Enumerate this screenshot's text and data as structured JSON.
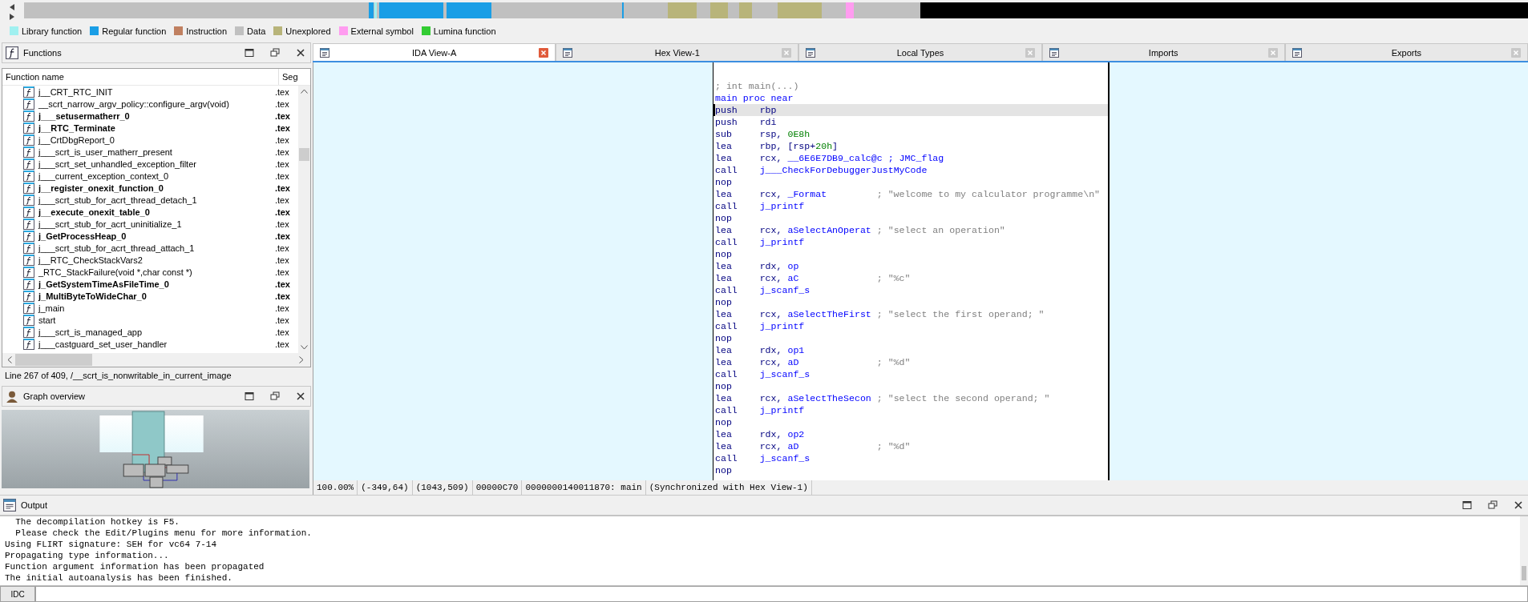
{
  "legend": [
    {
      "label": "Library function",
      "color": "#a0f0f0"
    },
    {
      "label": "Regular function",
      "color": "#1a9ee6"
    },
    {
      "label": "Instruction",
      "color": "#c08060"
    },
    {
      "label": "Data",
      "color": "#c0c0c0"
    },
    {
      "label": "Unexplored",
      "color": "#b8b47a"
    },
    {
      "label": "External symbol",
      "color": "#ff9cf0"
    },
    {
      "label": "Lumina function",
      "color": "#33cc33"
    }
  ],
  "functions_panel": {
    "title": "Functions",
    "columns": [
      "Function name",
      "Seg"
    ],
    "rows": [
      {
        "name": "j__CRT_RTC_INIT",
        "segment": ".tex",
        "bold": false
      },
      {
        "name": "__scrt_narrow_argv_policy::configure_argv(void)",
        "segment": ".tex",
        "bold": false
      },
      {
        "name": "j___setusermatherr_0",
        "segment": ".tex",
        "bold": true
      },
      {
        "name": "j__RTC_Terminate",
        "segment": ".tex",
        "bold": true
      },
      {
        "name": "j__CrtDbgReport_0",
        "segment": ".tex",
        "bold": false
      },
      {
        "name": "j___scrt_is_user_matherr_present",
        "segment": ".tex",
        "bold": false
      },
      {
        "name": "j___scrt_set_unhandled_exception_filter",
        "segment": ".tex",
        "bold": false
      },
      {
        "name": "j___current_exception_context_0",
        "segment": ".tex",
        "bold": false
      },
      {
        "name": "j__register_onexit_function_0",
        "segment": ".tex",
        "bold": true
      },
      {
        "name": "j___scrt_stub_for_acrt_thread_detach_1",
        "segment": ".tex",
        "bold": false
      },
      {
        "name": "j__execute_onexit_table_0",
        "segment": ".tex",
        "bold": true
      },
      {
        "name": "j___scrt_stub_for_acrt_uninitialize_1",
        "segment": ".tex",
        "bold": false
      },
      {
        "name": "j_GetProcessHeap_0",
        "segment": ".tex",
        "bold": true
      },
      {
        "name": "j___scrt_stub_for_acrt_thread_attach_1",
        "segment": ".tex",
        "bold": false
      },
      {
        "name": "j__RTC_CheckStackVars2",
        "segment": ".tex",
        "bold": false
      },
      {
        "name": "_RTC_StackFailure(void *,char const *)",
        "segment": ".tex",
        "bold": false
      },
      {
        "name": "j_GetSystemTimeAsFileTime_0",
        "segment": ".tex",
        "bold": true
      },
      {
        "name": "j_MultiByteToWideChar_0",
        "segment": ".tex",
        "bold": true
      },
      {
        "name": "j_main",
        "segment": ".tex",
        "bold": false
      },
      {
        "name": "start",
        "segment": ".tex",
        "bold": false
      },
      {
        "name": "j___scrt_is_managed_app",
        "segment": ".tex",
        "bold": false
      },
      {
        "name": "j___castguard_set_user_handler",
        "segment": ".tex",
        "bold": false
      }
    ],
    "status": "Line 267 of 409, /__scrt_is_nonwritable_in_current_image"
  },
  "graph_overview": {
    "title": "Graph overview"
  },
  "tabs": [
    {
      "label": "IDA View-A",
      "selected": true
    },
    {
      "label": "Hex View-1",
      "selected": false
    },
    {
      "label": "Local Types",
      "selected": false
    },
    {
      "label": "Imports",
      "selected": false
    },
    {
      "label": "Exports",
      "selected": false
    }
  ],
  "code": [
    {
      "kind": "comment",
      "text": "; int main(...)",
      "selected": false
    },
    {
      "kind": "label",
      "text": "main proc near",
      "selected": false
    },
    {
      "kind": "insn",
      "mnemonic": "push",
      "parts": [
        {
          "text": "rbp",
          "kind": "reg"
        }
      ],
      "selected": true
    },
    {
      "kind": "insn",
      "mnemonic": "push",
      "parts": [
        {
          "text": "rdi",
          "kind": "reg"
        }
      ],
      "selected": false
    },
    {
      "kind": "insn",
      "mnemonic": "sub",
      "parts": [
        {
          "text": "rsp, ",
          "kind": "reg"
        },
        {
          "text": "0E8h",
          "kind": "num"
        }
      ],
      "selected": false
    },
    {
      "kind": "insn",
      "mnemonic": "lea",
      "parts": [
        {
          "text": "rbp, [rsp+",
          "kind": "reg"
        },
        {
          "text": "20h",
          "kind": "num"
        },
        {
          "text": "]",
          "kind": "reg"
        }
      ],
      "selected": false
    },
    {
      "kind": "insn",
      "mnemonic": "lea",
      "parts": [
        {
          "text": "rcx, ",
          "kind": "reg"
        },
        {
          "text": "__6E6E7DB9_calc@c",
          "kind": "name"
        }
      ],
      "comment": {
        "text": "; JMC_flag",
        "kind": "name"
      },
      "selected": false
    },
    {
      "kind": "insn",
      "mnemonic": "call",
      "parts": [
        {
          "text": "j___CheckForDebuggerJustMyCode",
          "kind": "name"
        }
      ],
      "selected": false
    },
    {
      "kind": "insn",
      "mnemonic": "nop",
      "selected": false
    },
    {
      "kind": "insn",
      "mnemonic": "lea",
      "parts": [
        {
          "text": "rcx, ",
          "kind": "reg"
        },
        {
          "text": "_Format",
          "kind": "name"
        }
      ],
      "comment": {
        "text": "; \"welcome to my calculator programme\\n\"",
        "kind": "comment"
      },
      "selected": false
    },
    {
      "kind": "insn",
      "mnemonic": "call",
      "parts": [
        {
          "text": "j_printf",
          "kind": "name"
        }
      ],
      "selected": false
    },
    {
      "kind": "insn",
      "mnemonic": "nop",
      "selected": false
    },
    {
      "kind": "insn",
      "mnemonic": "lea",
      "parts": [
        {
          "text": "rcx, ",
          "kind": "reg"
        },
        {
          "text": "aSelectAnOperat",
          "kind": "name"
        }
      ],
      "comment": {
        "text": "; \"select an operation\"",
        "kind": "comment"
      },
      "selected": false
    },
    {
      "kind": "insn",
      "mnemonic": "call",
      "parts": [
        {
          "text": "j_printf",
          "kind": "name"
        }
      ],
      "selected": false
    },
    {
      "kind": "insn",
      "mnemonic": "nop",
      "selected": false
    },
    {
      "kind": "insn",
      "mnemonic": "lea",
      "parts": [
        {
          "text": "rdx, ",
          "kind": "reg"
        },
        {
          "text": "op",
          "kind": "name"
        }
      ],
      "selected": false
    },
    {
      "kind": "insn",
      "mnemonic": "lea",
      "parts": [
        {
          "text": "rcx, ",
          "kind": "reg"
        },
        {
          "text": "aC",
          "kind": "name"
        }
      ],
      "comment": {
        "text": "; \"%c\"",
        "kind": "comment"
      },
      "selected": false
    },
    {
      "kind": "insn",
      "mnemonic": "call",
      "parts": [
        {
          "text": "j_scanf_s",
          "kind": "name"
        }
      ],
      "selected": false
    },
    {
      "kind": "insn",
      "mnemonic": "nop",
      "selected": false
    },
    {
      "kind": "insn",
      "mnemonic": "lea",
      "parts": [
        {
          "text": "rcx, ",
          "kind": "reg"
        },
        {
          "text": "aSelectTheFirst",
          "kind": "name"
        }
      ],
      "comment": {
        "text": "; \"select the first operand; \"",
        "kind": "comment"
      },
      "selected": false
    },
    {
      "kind": "insn",
      "mnemonic": "call",
      "parts": [
        {
          "text": "j_printf",
          "kind": "name"
        }
      ],
      "selected": false
    },
    {
      "kind": "insn",
      "mnemonic": "nop",
      "selected": false
    },
    {
      "kind": "insn",
      "mnemonic": "lea",
      "parts": [
        {
          "text": "rdx, ",
          "kind": "reg"
        },
        {
          "text": "op1",
          "kind": "name"
        }
      ],
      "selected": false
    },
    {
      "kind": "insn",
      "mnemonic": "lea",
      "parts": [
        {
          "text": "rcx, ",
          "kind": "reg"
        },
        {
          "text": "aD",
          "kind": "name"
        }
      ],
      "comment": {
        "text": "; \"%d\"",
        "kind": "comment"
      },
      "selected": false
    },
    {
      "kind": "insn",
      "mnemonic": "call",
      "parts": [
        {
          "text": "j_scanf_s",
          "kind": "name"
        }
      ],
      "selected": false
    },
    {
      "kind": "insn",
      "mnemonic": "nop",
      "selected": false
    },
    {
      "kind": "insn",
      "mnemonic": "lea",
      "parts": [
        {
          "text": "rcx, ",
          "kind": "reg"
        },
        {
          "text": "aSelectTheSecon",
          "kind": "name"
        }
      ],
      "comment": {
        "text": "; \"select the second operand; \"",
        "kind": "comment"
      },
      "selected": false
    },
    {
      "kind": "insn",
      "mnemonic": "call",
      "parts": [
        {
          "text": "j_printf",
          "kind": "name"
        }
      ],
      "selected": false
    },
    {
      "kind": "insn",
      "mnemonic": "nop",
      "selected": false
    },
    {
      "kind": "insn",
      "mnemonic": "lea",
      "parts": [
        {
          "text": "rdx, ",
          "kind": "reg"
        },
        {
          "text": "op2",
          "kind": "name"
        }
      ],
      "selected": false
    },
    {
      "kind": "insn",
      "mnemonic": "lea",
      "parts": [
        {
          "text": "rcx, ",
          "kind": "reg"
        },
        {
          "text": "aD",
          "kind": "name"
        }
      ],
      "comment": {
        "text": "; \"%d\"",
        "kind": "comment"
      },
      "selected": false
    },
    {
      "kind": "insn",
      "mnemonic": "call",
      "parts": [
        {
          "text": "j_scanf_s",
          "kind": "name"
        }
      ],
      "selected": false
    },
    {
      "kind": "insn",
      "mnemonic": "nop",
      "selected": false
    }
  ],
  "view_status": [
    "100.00%",
    "(-349,64)",
    "(1043,509)",
    "00000C70",
    "0000000140011870: main",
    "(Synchronized with Hex View-1)"
  ],
  "output": {
    "title": "Output",
    "lines": [
      "  The decompilation hotkey is F5.",
      "  Please check the Edit/Plugins menu for more information.",
      "Using FLIRT signature: SEH for vc64 7-14",
      "Propagating type information...",
      "Function argument information has been propagated",
      "The initial autoanalysis has been finished."
    ],
    "language_button": "IDC"
  }
}
